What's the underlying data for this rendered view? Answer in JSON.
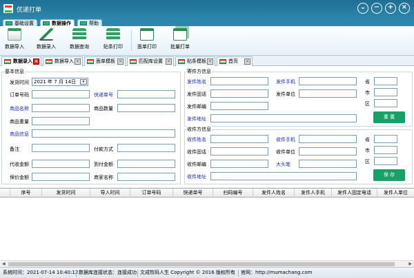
{
  "app": {
    "title": "优递打单"
  },
  "window_buttons": [
    "chevron-down",
    "minus",
    "plus",
    "close"
  ],
  "main_tabs": [
    {
      "label": "基础设置"
    },
    {
      "label": "数据操作"
    },
    {
      "label": "帮助"
    }
  ],
  "toolbar": {
    "buttons": [
      {
        "label": "数据导入",
        "icon": "import-icon"
      },
      {
        "label": "数据录入",
        "icon": "pen-icon"
      },
      {
        "label": "数据查询",
        "icon": "stack-icon"
      },
      {
        "label": "贴条打印",
        "icon": "layers-icon"
      },
      {
        "label": "面单打印",
        "icon": "window-icon"
      },
      {
        "label": "批量打单",
        "icon": "windows-icon"
      }
    ]
  },
  "doc_tabs": [
    {
      "label": "数据录入"
    },
    {
      "label": "数据导入"
    },
    {
      "label": "面单模板"
    },
    {
      "label": "匹配库设置"
    },
    {
      "label": "贴条模板"
    },
    {
      "label": "首页"
    }
  ],
  "basic": {
    "section": "基本信息",
    "send_time_label": "发货时间",
    "send_time_value": "2021 年  7 月 14日",
    "order_no_label": "订单号码",
    "tracking_label": "快递单号",
    "product_name_label": "商品名称",
    "product_qty_label": "商品数量",
    "product_weight_label": "商品重量",
    "product_info_label": "商品信息",
    "remark_label": "备注",
    "payment_label": "付款方式",
    "cod_label": "代收金额",
    "arrival_pay_label": "到付金额",
    "insured_label": "保价金额",
    "merchant_label": "商家名称"
  },
  "sender": {
    "section": "寄件方信息",
    "name_label": "发件姓名",
    "mobile_label": "发件手机",
    "phone_label": "发件固话",
    "company_label": "发件单位",
    "postcode_label": "发件邮编",
    "address_label": "发件地址",
    "province_label": "省",
    "city_label": "市",
    "district_label": "区",
    "reset_button": "重  置"
  },
  "receiver": {
    "section": "收件方信息",
    "name_label": "收件姓名",
    "mobile_label": "收件手机",
    "phone_label": "收件固话",
    "company_label": "收件单位",
    "postcode_label": "收件邮编",
    "bigpen_label": "大头笔",
    "address_label": "收件地址",
    "province_label": "省",
    "city_label": "市",
    "district_label": "区",
    "save_button": "保  存"
  },
  "grid": {
    "columns": [
      "序号",
      "发货时间",
      "导入时间",
      "订单号码",
      "快递单号",
      "扫码编号",
      "发件人姓名",
      "发件人手机",
      "发件人固定电话",
      "发件人单位"
    ]
  },
  "status": {
    "time": "系统时间：2021-07-14 10:40:12",
    "db": "数据库连接状态：连接成功",
    "copyright": "文成牧码人生 Copyright © 2016 版权所有",
    "site": "官网：http://mumachang.com"
  },
  "colors": {
    "titlebar": "#2c85aa",
    "accent_button": "#18a069",
    "blue_label": "#1a28c8"
  }
}
